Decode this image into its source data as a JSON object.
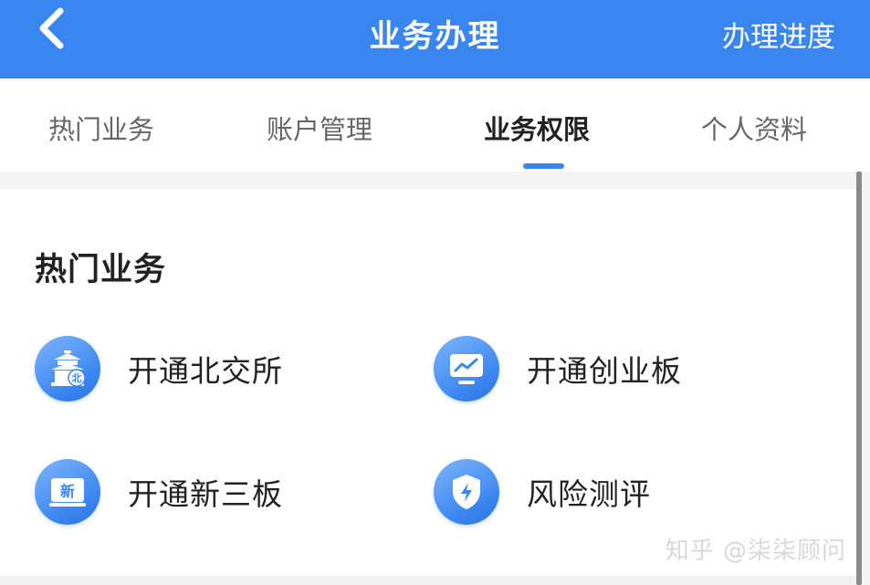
{
  "header": {
    "back_icon": "chevron-left-icon",
    "title": "业务办理",
    "action_label": "办理进度",
    "color": "#3a86f0"
  },
  "tabs": [
    {
      "label": "热门业务",
      "active": false
    },
    {
      "label": "账户管理",
      "active": false
    },
    {
      "label": "业务权限",
      "active": true
    },
    {
      "label": "个人资料",
      "active": false
    }
  ],
  "section": {
    "title": "热门业务",
    "services": [
      {
        "label": "开通北交所",
        "icon": "temple-bei-icon"
      },
      {
        "label": "开通创业板",
        "icon": "monitor-chart-icon"
      },
      {
        "label": "开通新三板",
        "icon": "screen-xin-icon"
      },
      {
        "label": "风险测评",
        "icon": "shield-lightning-icon"
      }
    ]
  },
  "watermark": "知乎 @柒柒顾问"
}
